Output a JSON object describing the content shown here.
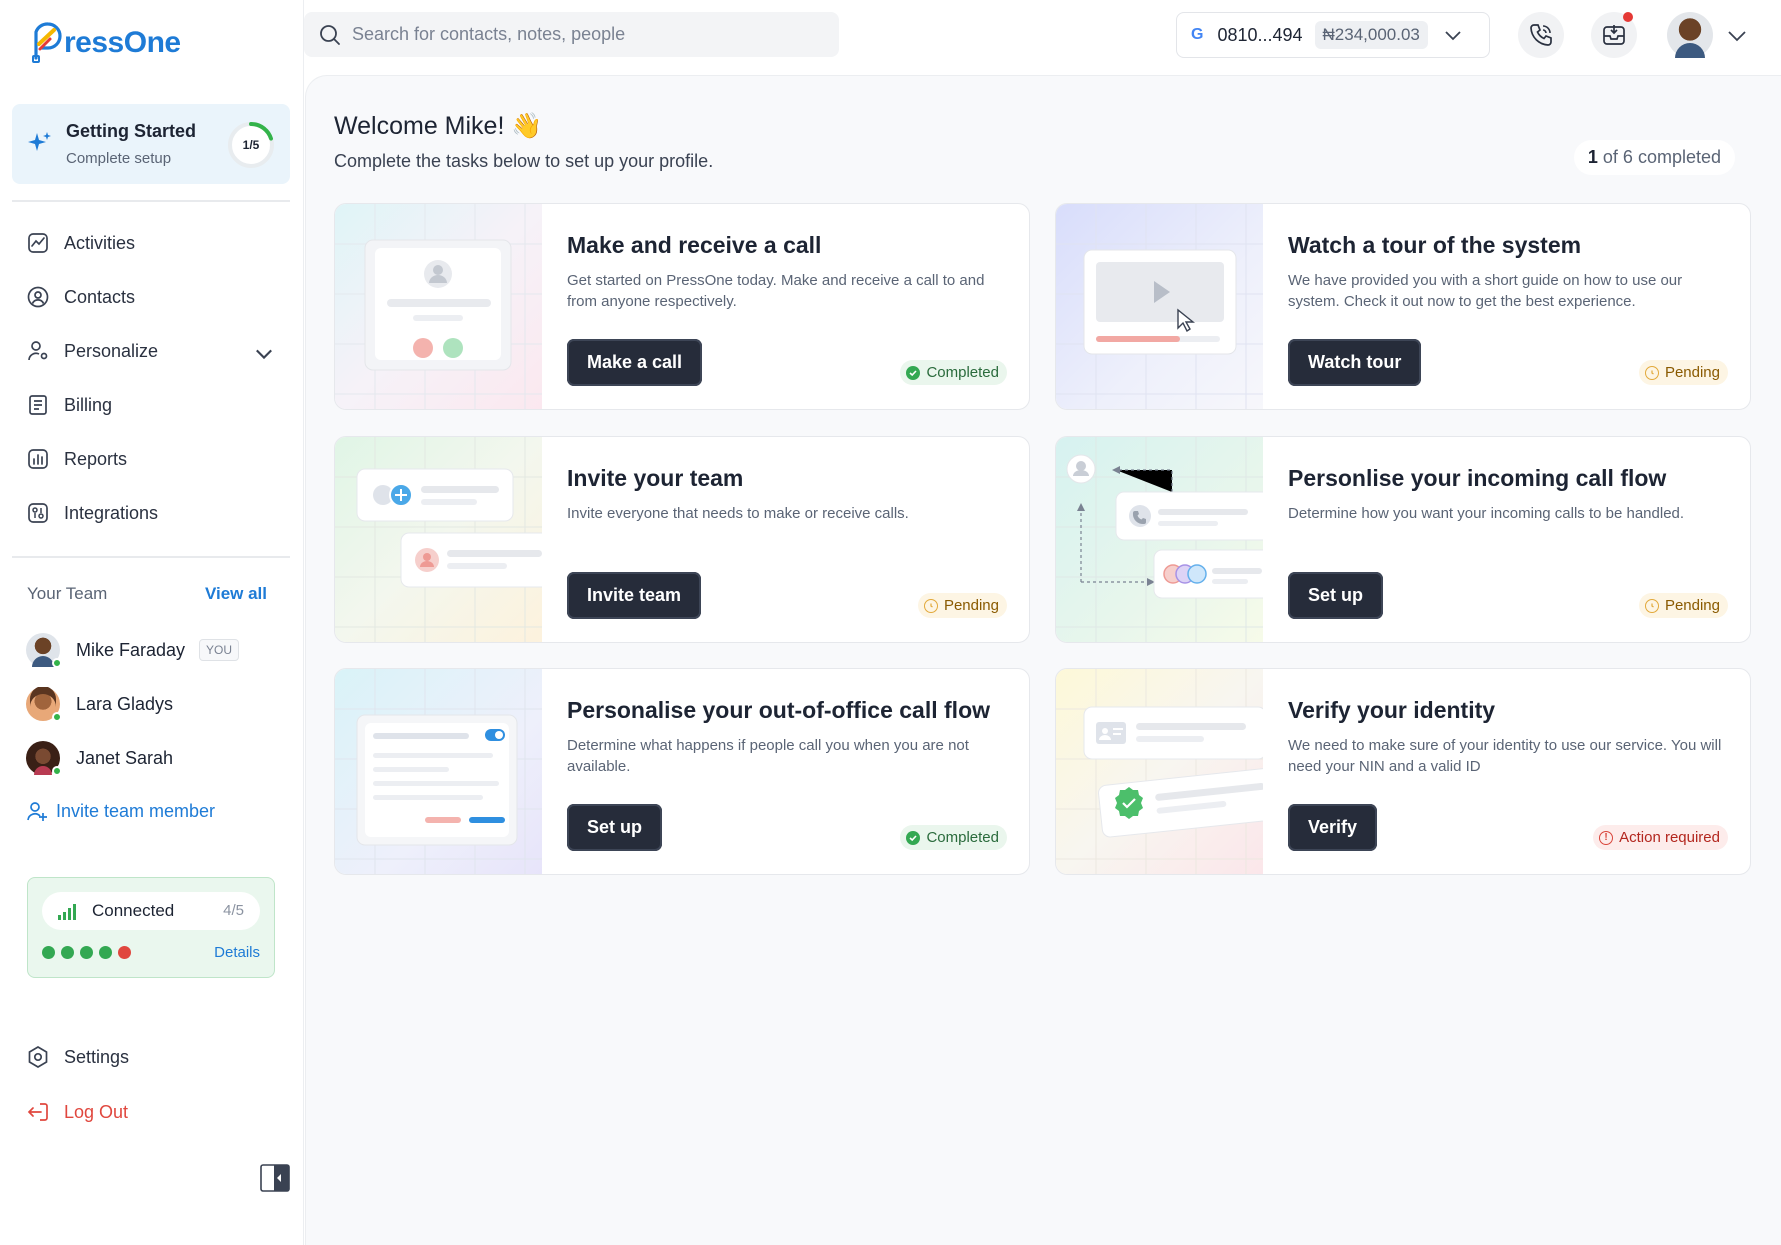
{
  "brand": {
    "logo_text": "ressOne",
    "accent": "#1e7bd6"
  },
  "search": {
    "placeholder": "Search for contacts, notes, people",
    "icon": "search-icon"
  },
  "account": {
    "provider_icon": "G",
    "number": "0810...494",
    "balance": "₦234,000.03"
  },
  "header": {
    "call_icon": "phone-icon",
    "inbox_icon": "inbox-icon",
    "has_notification": true
  },
  "getting_started": {
    "title": "Getting Started",
    "subtitle": "Complete setup",
    "progress_label": "1/5",
    "progress": 0.2
  },
  "nav": [
    {
      "label": "Activities",
      "icon": "activity-icon"
    },
    {
      "label": "Contacts",
      "icon": "contact-icon"
    },
    {
      "label": "Personalize",
      "icon": "personalize-icon"
    },
    {
      "label": "Billing",
      "icon": "billing-icon"
    },
    {
      "label": "Reports",
      "icon": "reports-icon"
    },
    {
      "label": "Integrations",
      "icon": "integrations-icon"
    }
  ],
  "team": {
    "heading": "Your Team",
    "view_all": "View all",
    "members": [
      {
        "name": "Mike Faraday",
        "badge": "YOU",
        "online": true
      },
      {
        "name": "Lara Gladys",
        "online": true
      },
      {
        "name": "Janet Sarah",
        "online": true
      }
    ],
    "invite_label": "Invite team member"
  },
  "connection": {
    "label": "Connected",
    "count": "4/5",
    "details": "Details",
    "statuses": [
      "ok",
      "ok",
      "ok",
      "ok",
      "error"
    ],
    "status_color": "#33a852"
  },
  "footer_nav": {
    "settings": "Settings",
    "logout": "Log Out"
  },
  "main": {
    "welcome": "Welcome Mike! 👋",
    "subtitle": "Complete the tasks below to set up your profile.",
    "progress_done": "1",
    "progress_rest": " of 6 completed"
  },
  "tasks": [
    {
      "title": "Make and receive a call",
      "desc": "Get started on PressOne today. Make and receive a call to and from anyone respectively.",
      "button": "Make a call",
      "status": "Completed"
    },
    {
      "title": "Watch a tour of the system",
      "desc": "We have provided you with a short guide on how to use our system. Check it out now to get the best experience.",
      "button": "Watch tour",
      "status": "Pending"
    },
    {
      "title": "Invite your team",
      "desc": "Invite everyone that needs to make or receive calls.",
      "button": "Invite team",
      "status": "Pending"
    },
    {
      "title": "Personlise your incoming call flow",
      "desc": "Determine how you want your incoming calls to be handled.",
      "button": "Set up",
      "status": "Pending"
    },
    {
      "title": "Personalise your out-of-office call flow",
      "desc": "Determine what happens if people call you when you are not available.",
      "button": "Set up",
      "status": "Completed"
    },
    {
      "title": "Verify your identity",
      "desc": "We need to make sure of your identity to use our service. You will need your NIN and a valid ID",
      "button": "Verify",
      "status": "Action required"
    }
  ]
}
